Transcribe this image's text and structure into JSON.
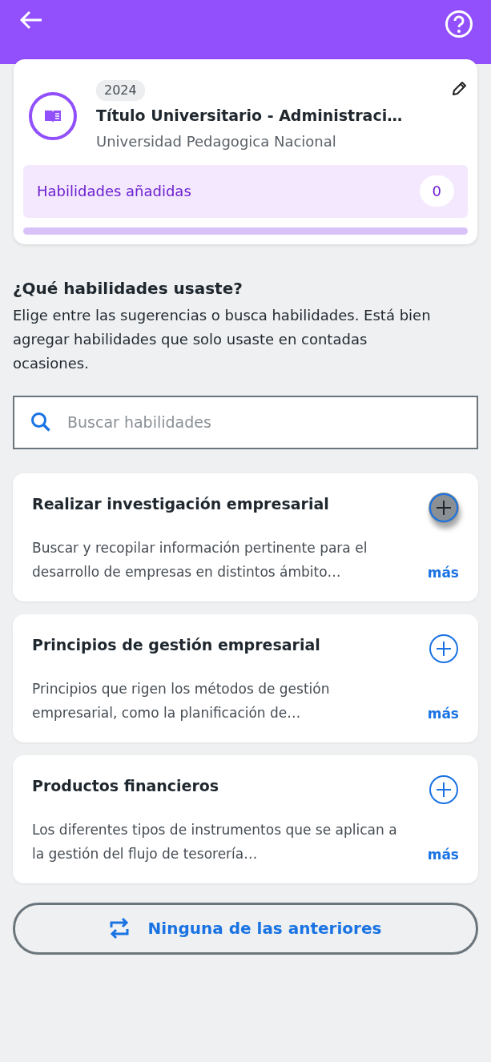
{
  "education": {
    "year": "2024",
    "title": "Título Universitario - Administraci…",
    "institution": "Universidad Pedagogica Nacional",
    "skills_label": "Habilidades añadidas",
    "skills_count": "0"
  },
  "prompt": {
    "heading": "¿Qué habilidades usaste?",
    "text": "Elige entre las sugerencias o busca habilidades. Está bien agregar habilidades que solo usaste en contadas ocasiones."
  },
  "search": {
    "placeholder": "Buscar habilidades"
  },
  "skills": [
    {
      "name": "Realizar investigación empresarial",
      "description": "Buscar y recopilar información pertinente para el desarrollo de empresas en distintos ámbito…",
      "more": "más",
      "pressed": true
    },
    {
      "name": "Principios de gestión empresarial",
      "description": "Principios que rigen los métodos de gestión empresarial, como la planificación de…",
      "more": "más",
      "pressed": false
    },
    {
      "name": "Productos financieros",
      "description": "Los diferentes tipos de instrumentos que se aplican a la gestión del flujo de tesorería…",
      "more": "más",
      "pressed": false
    }
  ],
  "none_button": "Ninguna de las anteriores"
}
